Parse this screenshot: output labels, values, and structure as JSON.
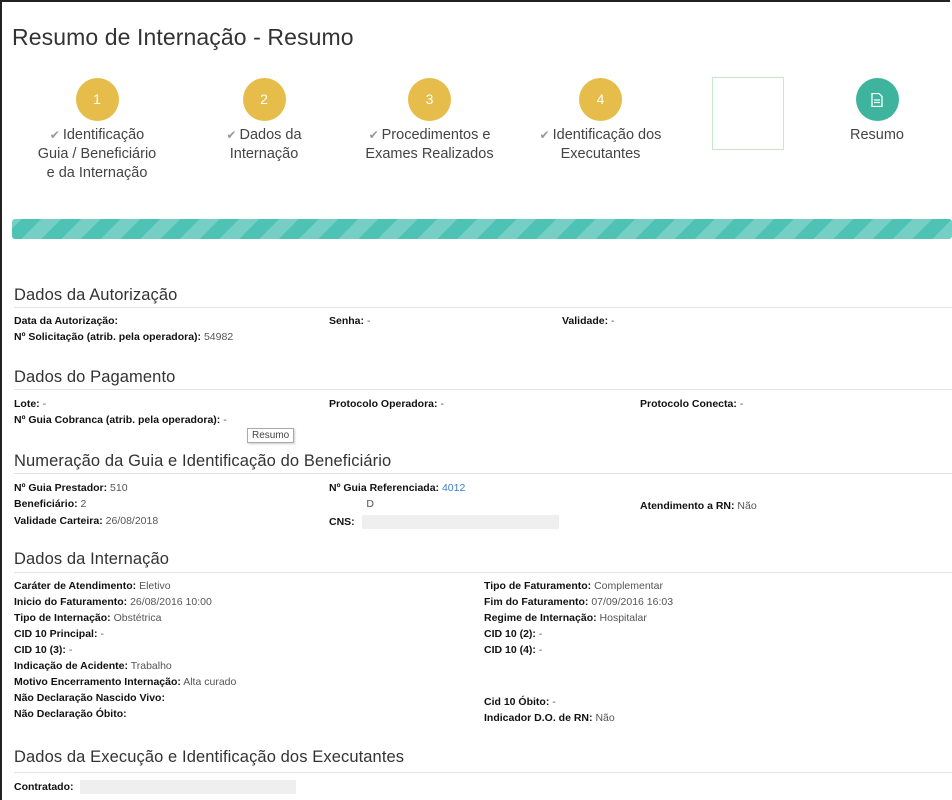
{
  "page": {
    "title": "Resumo de Internação - Resumo"
  },
  "wizard": {
    "steps": [
      {
        "number": "1",
        "label": "Identificação Guia / Beneficiário e da Internação"
      },
      {
        "number": "2",
        "label": "Dados da Internação"
      },
      {
        "number": "3",
        "label": "Procedimentos e Exames Realizados"
      },
      {
        "number": "4",
        "label": "Identificação dos Executantes"
      },
      {
        "label": "Resumo"
      }
    ],
    "check_glyph": "✔",
    "colors": {
      "done": "#e6bd4a",
      "active": "#3eb39e",
      "progress": "#4ec2b4"
    }
  },
  "tooltip": {
    "text": "Resumo"
  },
  "sections": {
    "autorizacao": {
      "title": "Dados da Autorização",
      "data_autorizacao_label": "Data da Autorização:",
      "data_autorizacao_value": "",
      "senha_label": "Senha:",
      "senha_value": "-",
      "validade_label": "Validade:",
      "validade_value": "-",
      "solicitacao_label": "Nº Solicitação (atrib. pela operadora):",
      "solicitacao_value": "54982"
    },
    "pagamento": {
      "title": "Dados do Pagamento",
      "lote_label": "Lote:",
      "lote_value": "-",
      "protocolo_operadora_label": "Protocolo Operadora:",
      "protocolo_operadora_value": "-",
      "protocolo_conecta_label": "Protocolo Conecta:",
      "protocolo_conecta_value": "-",
      "guia_cobranca_label": "Nº Guia Cobranca (atrib. pela operadora):",
      "guia_cobranca_value": "-"
    },
    "guia": {
      "title": "Numeração da Guia e Identificação do Beneficiário",
      "guia_prestador_label": "Nº Guia Prestador:",
      "guia_prestador_value": "510",
      "guia_referenciada_label": "Nº Guia Referenciada:",
      "guia_referenciada_value": "4012",
      "beneficiario_label": "Beneficiário:",
      "beneficiario_value": "2",
      "beneficiario_tail": "D",
      "atendimento_rn_label": "Atendimento a RN:",
      "atendimento_rn_value": "Não",
      "validade_carteira_label": "Validade Carteira:",
      "validade_carteira_value": "26/08/2018",
      "cns_label": "CNS:"
    },
    "internacao": {
      "title": "Dados da Internação",
      "left": [
        {
          "label": "Caráter de Atendimento:",
          "value": "Eletivo"
        },
        {
          "label": "Inicio do Faturamento:",
          "value": "26/08/2016 10:00"
        },
        {
          "label": "Tipo de Internação:",
          "value": "Obstétrica"
        },
        {
          "label": "CID 10 Principal:",
          "value": "-"
        },
        {
          "label": "CID 10 (3):",
          "value": "-"
        },
        {
          "label": "Indicação de Acidente:",
          "value": "Trabalho"
        },
        {
          "label": "Motivo Encerramento Internação:",
          "value": "Alta curado"
        },
        {
          "label": "Não Declaração Nascido Vivo:",
          "value": ""
        },
        {
          "label": "Não Declaração Óbito:",
          "value": ""
        }
      ],
      "right": [
        {
          "label": "Tipo de Faturamento:",
          "value": "Complementar"
        },
        {
          "label": "Fim do Faturamento:",
          "value": "07/09/2016 16:03"
        },
        {
          "label": "Regime de Internação:",
          "value": "Hospitalar"
        },
        {
          "label": "CID 10 (2):",
          "value": "-"
        },
        {
          "label": "CID 10 (4):",
          "value": "-"
        },
        {
          "label": "Cid 10 Óbito:",
          "value": "-"
        },
        {
          "label": "Indicador D.O. de RN:",
          "value": "Não"
        }
      ]
    },
    "execucao": {
      "title": "Dados da Execução e Identificação dos Executantes",
      "contratado_label": "Contratado:"
    }
  }
}
